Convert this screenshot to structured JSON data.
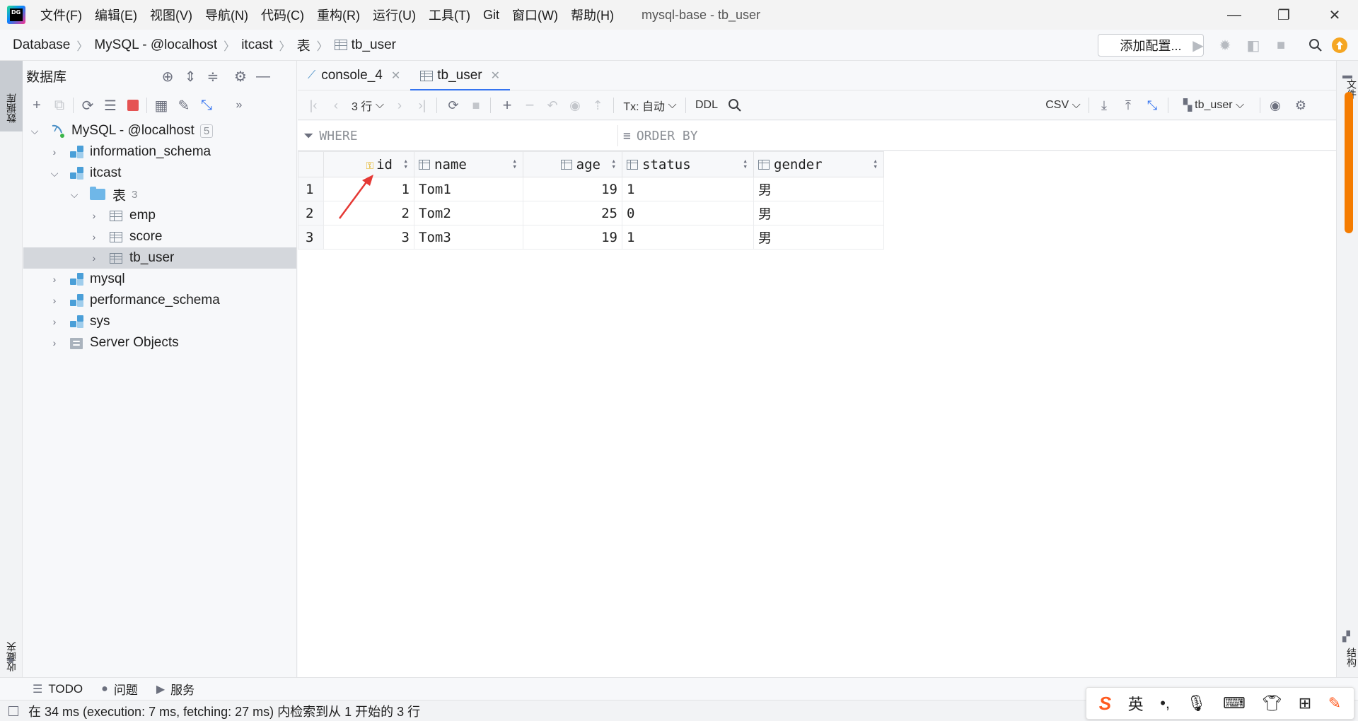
{
  "app": {
    "logo_text": "DG",
    "menu": [
      "文件(F)",
      "编辑(E)",
      "视图(V)",
      "导航(N)",
      "代码(C)",
      "重构(R)",
      "运行(U)",
      "工具(T)",
      "Git",
      "窗口(W)",
      "帮助(H)"
    ],
    "window_title": "mysql-base - tb_user"
  },
  "breadcrumb": [
    "Database",
    "MySQL - @localhost",
    "itcast",
    "表",
    "tb_user"
  ],
  "navbar": {
    "add_config_label": "添加配置..."
  },
  "left_strip": {
    "database_label": "数据库",
    "favorites_label": "收藏夹"
  },
  "db_panel": {
    "title": "数据库",
    "tree": [
      {
        "label": "MySQL - @localhost",
        "count": "5",
        "level": 0,
        "expanded": true,
        "kind": "connection"
      },
      {
        "label": "information_schema",
        "level": 1,
        "expanded": false,
        "kind": "schema"
      },
      {
        "label": "itcast",
        "level": 1,
        "expanded": true,
        "kind": "schema"
      },
      {
        "label": "表",
        "count": "3",
        "level": 2,
        "expanded": true,
        "kind": "folder"
      },
      {
        "label": "emp",
        "level": 3,
        "expanded": false,
        "kind": "table"
      },
      {
        "label": "score",
        "level": 3,
        "expanded": false,
        "kind": "table"
      },
      {
        "label": "tb_user",
        "level": 3,
        "expanded": false,
        "kind": "table",
        "selected": true
      },
      {
        "label": "mysql",
        "level": 1,
        "expanded": false,
        "kind": "schema"
      },
      {
        "label": "performance_schema",
        "level": 1,
        "expanded": false,
        "kind": "schema"
      },
      {
        "label": "sys",
        "level": 1,
        "expanded": false,
        "kind": "schema"
      },
      {
        "label": "Server Objects",
        "level": 1,
        "expanded": false,
        "kind": "server"
      }
    ]
  },
  "right_strip": {
    "file_label": "文件",
    "structure_label": "结构"
  },
  "editor_tabs": [
    {
      "label": "console_4",
      "active": false
    },
    {
      "label": "tb_user",
      "active": true
    }
  ],
  "grid_toolbar": {
    "rows_label": "3 行",
    "tx_label": "Tx: 自动",
    "ddl_label": "DDL",
    "export_format": "CSV",
    "datasource_label": "tb_user"
  },
  "filter": {
    "where_placeholder": "WHERE",
    "order_by_placeholder": "ORDER BY"
  },
  "grid": {
    "columns": [
      {
        "name": "id",
        "key": true
      },
      {
        "name": "name"
      },
      {
        "name": "age"
      },
      {
        "name": "status"
      },
      {
        "name": "gender"
      }
    ],
    "rows": [
      {
        "num": "1",
        "id": "1",
        "name": "Tom1",
        "age": "19",
        "status": "1",
        "gender": "男"
      },
      {
        "num": "2",
        "id": "2",
        "name": "Tom2",
        "age": "25",
        "status": "0",
        "gender": "男"
      },
      {
        "num": "3",
        "id": "3",
        "name": "Tom3",
        "age": "19",
        "status": "1",
        "gender": "男"
      }
    ]
  },
  "bottom_tools": [
    {
      "icon": "list-icon",
      "label": "TODO"
    },
    {
      "icon": "problems-icon",
      "label": "问题"
    },
    {
      "icon": "services-icon",
      "label": "服务"
    }
  ],
  "status": {
    "message": "在 34 ms (execution: 7 ms, fetching: 27 ms) 内检索到从 1 开始的 3 行"
  },
  "ime": {
    "mode_label": "英"
  },
  "colors": {
    "accent": "#3574f0",
    "scroll_marker": "#f57c00",
    "stop_red": "#e55353",
    "update_badge": "#f5a623"
  }
}
